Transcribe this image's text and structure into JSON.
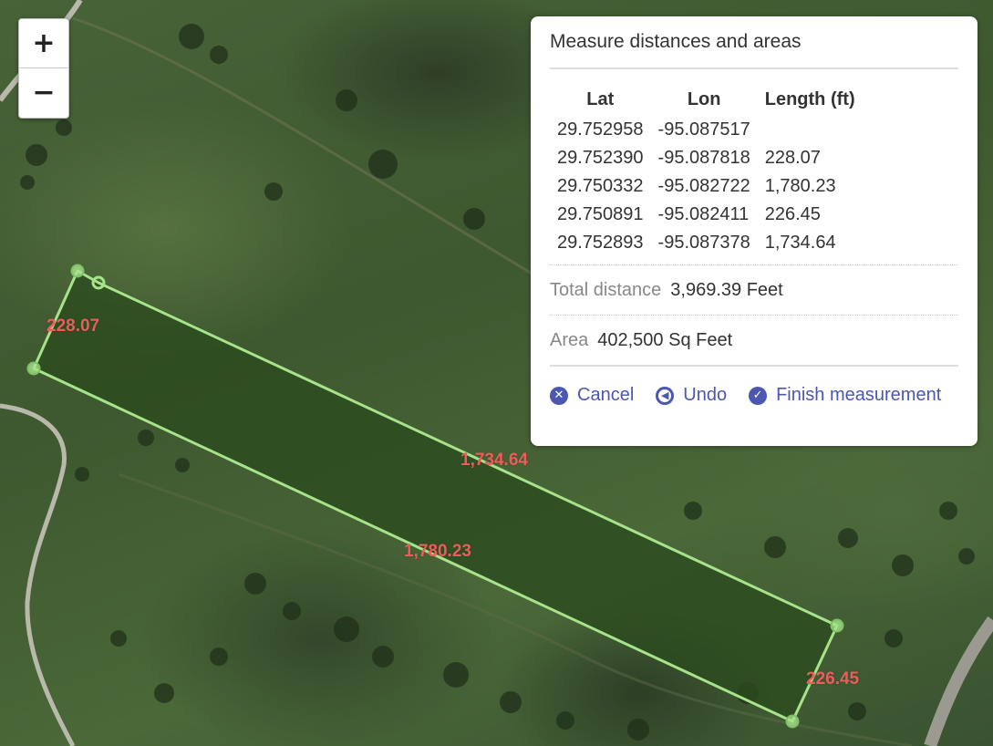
{
  "zoom": {
    "in_label": "+",
    "out_label": "−"
  },
  "panel": {
    "title": "Measure distances and areas",
    "columns": [
      "Lat",
      "Lon",
      "Length (ft)"
    ],
    "rows": [
      [
        "29.752958",
        "-95.087517",
        ""
      ],
      [
        "29.752390",
        "-95.087818",
        "228.07"
      ],
      [
        "29.750332",
        "-95.082722",
        "1,780.23"
      ],
      [
        "29.750891",
        "-95.082411",
        "226.45"
      ],
      [
        "29.752893",
        "-95.087378",
        "1,734.64"
      ]
    ],
    "total_label": "Total distance",
    "total_value": "3,969.39 Feet",
    "area_label": "Area",
    "area_value": "402,500 Sq Feet",
    "actions": {
      "cancel": "Cancel",
      "undo": "Undo",
      "finish": "Finish measurement"
    }
  },
  "segment_labels": {
    "a": "228.07",
    "b": "1,734.64",
    "c": "1,780.23",
    "d": "226.45"
  },
  "colors": {
    "accent": "#4b57b0",
    "polygon_stroke": "#a6e38a",
    "segment_label": "#ee5b5b"
  }
}
